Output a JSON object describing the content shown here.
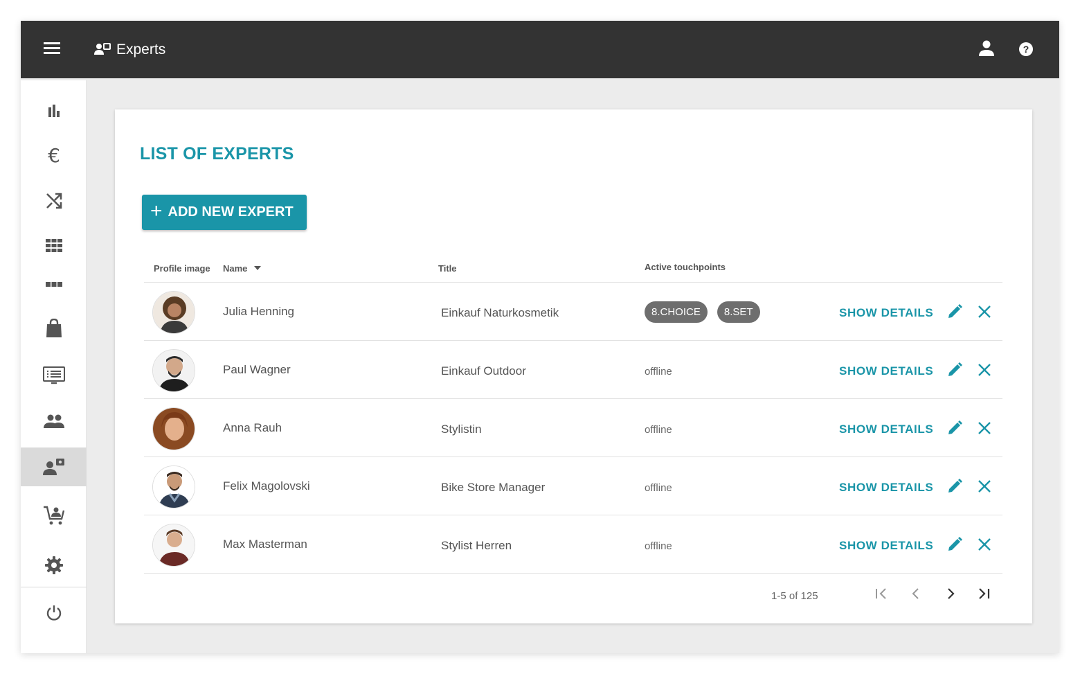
{
  "topbar": {
    "title": "Experts",
    "menu_icon": "hamburger-icon",
    "title_icon": "experts-icon",
    "user_icon": "person-icon",
    "help_icon": "help-icon"
  },
  "sidebar": {
    "items": [
      {
        "icon": "bar-chart-icon"
      },
      {
        "icon": "euro-icon"
      },
      {
        "icon": "shuffle-icon"
      },
      {
        "icon": "grid-icon"
      },
      {
        "icon": "view-strip-icon"
      },
      {
        "icon": "shopping-bag-icon"
      },
      {
        "icon": "screen-list-icon"
      },
      {
        "icon": "group-icon"
      },
      {
        "icon": "experts-icon",
        "active": true
      },
      {
        "icon": "cart-person-icon"
      },
      {
        "icon": "settings-icon"
      },
      {
        "icon": "power-icon"
      }
    ]
  },
  "main": {
    "heading": "LIST OF EXPERTS",
    "add_button": "ADD NEW EXPERT",
    "columns": {
      "profile_image": "Profile image",
      "name": "Name",
      "title": "Title",
      "active_touchpoints": "Active touchpoints"
    },
    "rows": [
      {
        "name": "Julia Henning",
        "title": "Einkauf Naturkosmetik",
        "touchpoints": [
          "8.CHOICE",
          "8.SET"
        ],
        "status": ""
      },
      {
        "name": "Paul Wagner",
        "title": "Einkauf Outdoor",
        "touchpoints": [],
        "status": "offline"
      },
      {
        "name": "Anna Rauh",
        "title": "Stylistin",
        "touchpoints": [],
        "status": "offline"
      },
      {
        "name": "Felix Magolovski",
        "title": "Bike Store Manager",
        "touchpoints": [],
        "status": "offline"
      },
      {
        "name": "Max Masterman",
        "title": "Stylist Herren",
        "touchpoints": [],
        "status": "offline"
      }
    ],
    "row_action": "SHOW DETAILS",
    "pagination": "1-5 of 125"
  },
  "colors": {
    "accent": "#1a95a8",
    "topbar": "#333333",
    "chip": "#6e6e6e"
  }
}
